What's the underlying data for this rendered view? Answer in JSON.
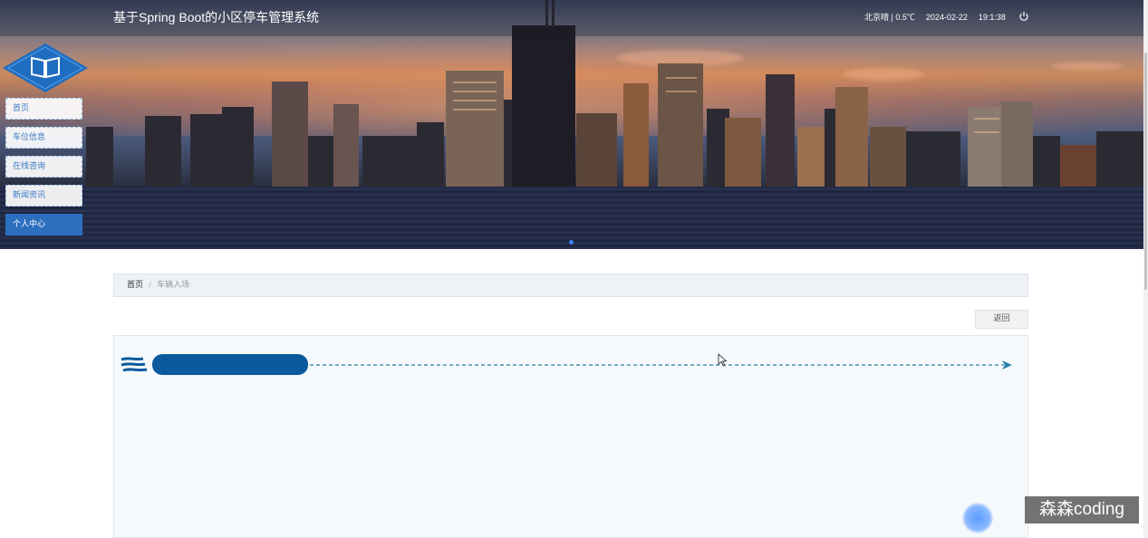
{
  "header": {
    "title": "基于Spring Boot的小区停车管理系统",
    "weather": "北京晴 | 0.5℃",
    "date": "2024-02-22",
    "time": "19:1:38",
    "power_icon": "power-icon"
  },
  "sidebar": {
    "logo_icon": "book-icon",
    "items": [
      {
        "label": "首页",
        "active": false
      },
      {
        "label": "车位信息",
        "active": false
      },
      {
        "label": "在线咨询",
        "active": false
      },
      {
        "label": "新闻资讯",
        "active": false
      },
      {
        "label": "个人中心",
        "active": true
      }
    ]
  },
  "breadcrumb": {
    "home": "首页",
    "separator": "/",
    "current": "车辆入场"
  },
  "actions": {
    "back_label": "返回"
  },
  "watermark": {
    "text": "森森coding"
  },
  "colors": {
    "accent": "#2d6fbf",
    "loader": "#0b5a9e",
    "arrow": "#2a7fa8"
  }
}
